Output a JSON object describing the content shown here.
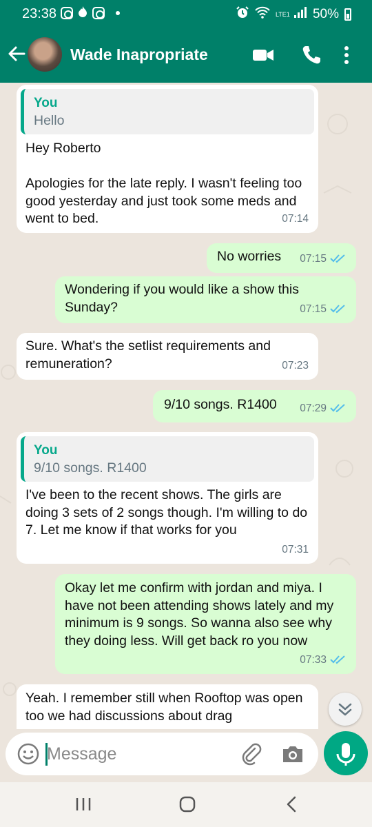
{
  "status_bar": {
    "time": "23:38",
    "battery": "50%",
    "network": "LTE1"
  },
  "header": {
    "contact_name": "Wade Inapropriate"
  },
  "messages": [
    {
      "dir": "in",
      "quote_author": "You",
      "quote_text": "Hello",
      "text": "Hey Roberto\n\nApologies for the late reply. I wasn't feeling too good yesterday and just took some meds and went to bed.",
      "time": "07:14"
    },
    {
      "dir": "out",
      "text": "No worries",
      "time": "07:15"
    },
    {
      "dir": "out",
      "text": "Wondering if you would like a show this Sunday?",
      "time": "07:15"
    },
    {
      "dir": "in",
      "text": "Sure. What's the setlist requirements and remuneration?",
      "time": "07:23"
    },
    {
      "dir": "out",
      "text": "9/10 songs. R1400",
      "time": "07:29"
    },
    {
      "dir": "in",
      "quote_author": "You",
      "quote_text": "9/10 songs. R1400",
      "text": "I've been to the recent shows. The girls are doing 3 sets of 2 songs though. I'm willing to do 7. Let me know if that works for you",
      "time": "07:31"
    },
    {
      "dir": "out",
      "text": "Okay let me confirm with jordan and miya. I have not been attending shows lately and my minimum is 9 songs. So wanna also see why they doing less. Will get back ro you now",
      "time": "07:33"
    },
    {
      "dir": "in",
      "text": "Yeah. I remember still when Rooftop was open too we had discussions about drag"
    }
  ],
  "input": {
    "placeholder": "Message"
  },
  "colors": {
    "header": "#008069",
    "outgoing_bubble": "#d9fdd3",
    "incoming_bubble": "#ffffff",
    "accent": "#00a884",
    "read_ticks": "#53bdeb",
    "chat_bg": "#ece5dd"
  },
  "icons": [
    "back-arrow-icon",
    "video-call-icon",
    "phone-icon",
    "more-vert-icon",
    "emoji-icon",
    "attach-icon",
    "camera-icon",
    "mic-icon",
    "double-chevron-down-icon",
    "recents-icon",
    "home-icon",
    "back-icon"
  ]
}
